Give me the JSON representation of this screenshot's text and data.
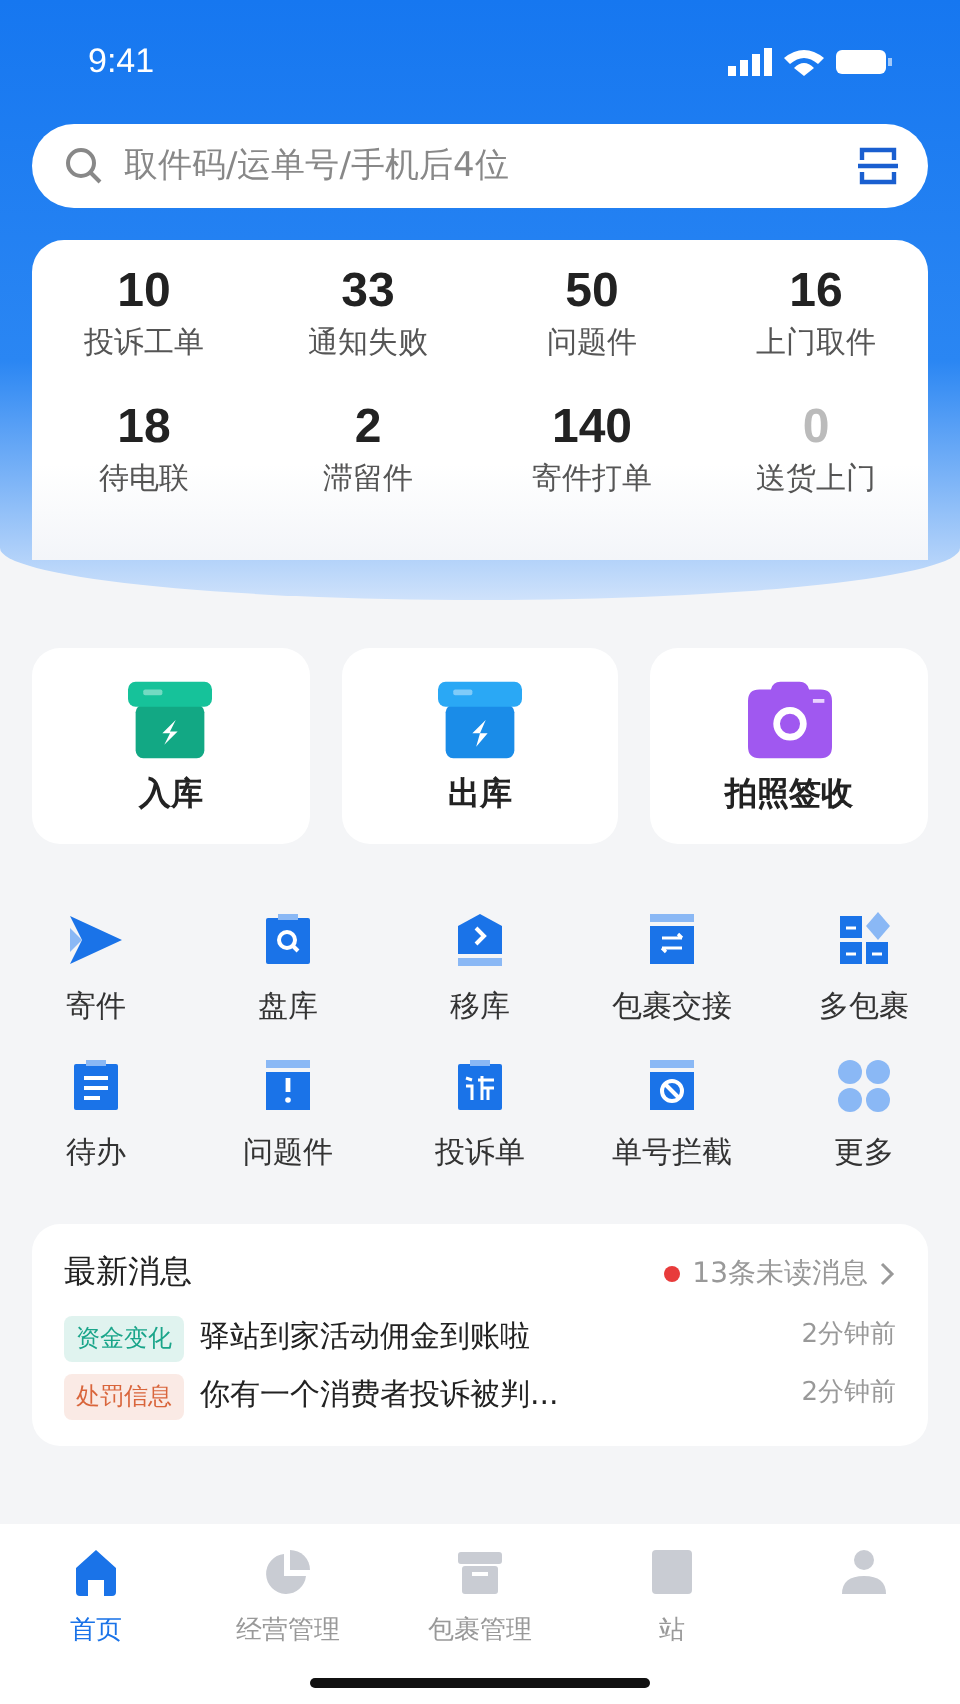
{
  "status_bar": {
    "time": "9:41"
  },
  "search": {
    "placeholder": "取件码/运单号/手机后4位"
  },
  "stats": [
    {
      "value": "10",
      "label": "投诉工单",
      "dimmed": false
    },
    {
      "value": "33",
      "label": "通知失败",
      "dimmed": false
    },
    {
      "value": "50",
      "label": "问题件",
      "dimmed": false
    },
    {
      "value": "16",
      "label": "上门取件",
      "dimmed": false
    },
    {
      "value": "18",
      "label": "待电联",
      "dimmed": false
    },
    {
      "value": "2",
      "label": "滞留件",
      "dimmed": false
    },
    {
      "value": "140",
      "label": "寄件打单",
      "dimmed": false
    },
    {
      "value": "0",
      "label": "送货上门",
      "dimmed": true
    }
  ],
  "main_actions": [
    {
      "label": "入库"
    },
    {
      "label": "出库"
    },
    {
      "label": "拍照签收"
    }
  ],
  "shortcuts": [
    {
      "label": "寄件"
    },
    {
      "label": "盘库"
    },
    {
      "label": "移库"
    },
    {
      "label": "包裹交接"
    },
    {
      "label": "多包裹"
    },
    {
      "label": "待办"
    },
    {
      "label": "问题件"
    },
    {
      "label": "投诉单"
    },
    {
      "label": "单号拦截"
    },
    {
      "label": "更多"
    }
  ],
  "messages": {
    "title": "最新消息",
    "unread": "13条未读消息",
    "items": [
      {
        "tag": "资金变化",
        "color": "#1aa58a",
        "text": "驿站到家活动佣金到账啦",
        "time": "2分钟前"
      },
      {
        "tag": "处罚信息",
        "color": "#d9653b",
        "text": "你有一个消费者投诉被判...",
        "time": "2分钟前"
      }
    ]
  },
  "tab_bar": [
    {
      "label": "首页",
      "selected": true
    },
    {
      "label": "经营管理",
      "selected": false
    },
    {
      "label": "包裹管理",
      "selected": false
    },
    {
      "label": "站",
      "selected": false
    },
    {
      "selected": false
    }
  ]
}
